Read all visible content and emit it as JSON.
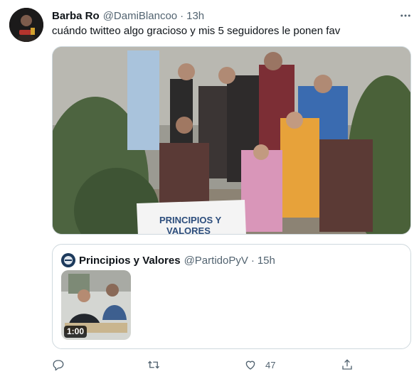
{
  "tweet": {
    "author_name": "Barba Ro",
    "author_handle": "@DamiBlancoo",
    "separator": "·",
    "time": "13h",
    "text": "cuándo twitteo algo gracioso y mis 5 seguidores le ponen fav",
    "banner_text_line1": "PRINCIPIOS Y",
    "banner_text_line2": "VALORES"
  },
  "quote": {
    "author_name": "Principios y Valores",
    "author_handle": "@PartidoPyV",
    "separator": "·",
    "time": "15h",
    "video_duration": "1:00"
  },
  "actions": {
    "reply_icon": "reply-icon",
    "retweet_icon": "retweet-icon",
    "like_icon": "heart-icon",
    "like_count": "47",
    "share_icon": "share-icon"
  },
  "colors": {
    "text_primary": "#0f1419",
    "text_secondary": "#536471",
    "border": "#cfd9de"
  }
}
